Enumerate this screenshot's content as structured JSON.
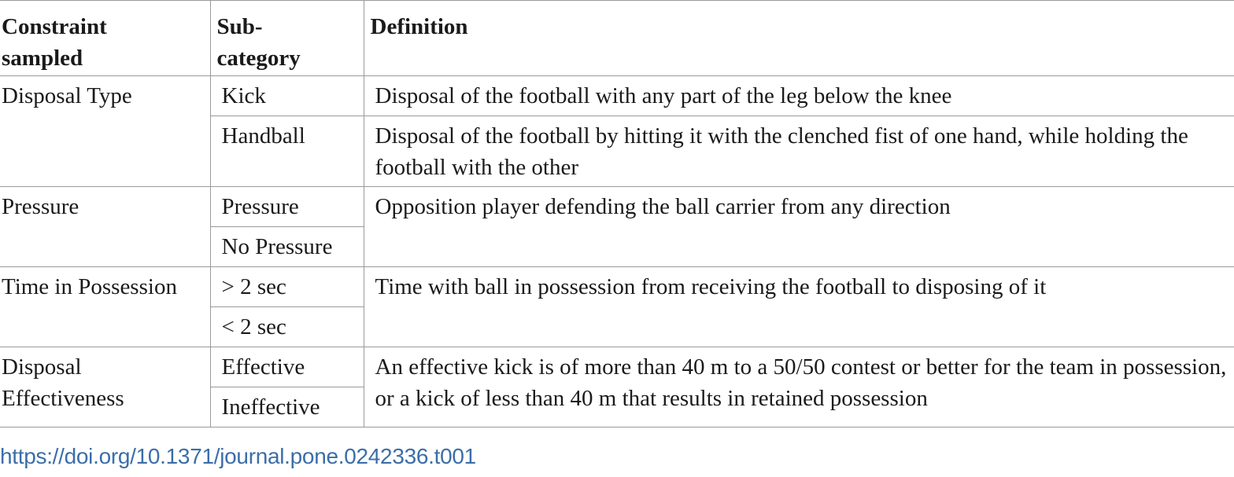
{
  "table": {
    "headers": [
      "Constraint sampled",
      "Sub-category",
      "Definition"
    ],
    "header_lines": {
      "constraint": [
        "Constraint",
        "sampled"
      ],
      "subcategory": [
        "Sub-",
        "category"
      ],
      "definition": "Definition"
    },
    "groups": [
      {
        "constraint": "Disposal Type",
        "rows": [
          {
            "sub": "Kick",
            "definition": "Disposal of the football with any part of the leg below the knee"
          },
          {
            "sub": "Handball",
            "definition": "Disposal of the football by hitting it with the clenched fist of one hand, while holding the football with the other"
          }
        ]
      },
      {
        "constraint": "Pressure",
        "definition": "Opposition player defending the ball carrier from any direction",
        "rows": [
          {
            "sub": "Pressure"
          },
          {
            "sub": "No Pressure"
          }
        ]
      },
      {
        "constraint": "Time in Possession",
        "definition": "Time with ball in possession from receiving the football to disposing of it",
        "rows": [
          {
            "sub": "> 2 sec"
          },
          {
            "sub": "< 2 sec"
          }
        ]
      },
      {
        "constraint": "Disposal Effectiveness",
        "definition": "An effective kick is of more than 40 m to a 50/50 contest or better for the team in possession, or a kick of less than 40 m that results in retained possession",
        "rows": [
          {
            "sub": "Effective"
          },
          {
            "sub": "Ineffective"
          }
        ]
      }
    ]
  },
  "doi_link": "https://doi.org/10.1371/journal.pone.0242336.t001"
}
